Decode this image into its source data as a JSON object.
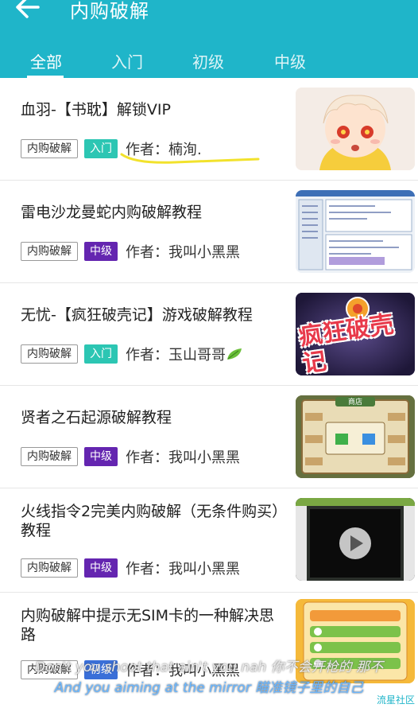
{
  "header": {
    "title": "内购破解"
  },
  "tabs": [
    "全部",
    "入门",
    "初级",
    "中级"
  ],
  "colors": {
    "accent": "#1fb5c9",
    "level_entry": "#2cc6b3",
    "level_mid": "#6425b0"
  },
  "items": [
    {
      "title": "血羽-【书耽】解锁VIP",
      "category": "内购破解",
      "level": "入门",
      "author": "作者：楠洵."
    },
    {
      "title": "雷电沙龙曼蛇内购破解教程",
      "category": "内购破解",
      "level": "中级",
      "author": "作者：我叫小黑黑"
    },
    {
      "title": "无忧-【疯狂破壳记】游戏破解教程",
      "category": "内购破解",
      "level": "入门",
      "author": "作者：玉山哥哥"
    },
    {
      "title": "贤者之石起源破解教程",
      "category": "内购破解",
      "level": "中级",
      "author": "作者：我叫小黑黑"
    },
    {
      "title": "火线指令2完美内购破解（无条件购买）教程",
      "category": "内购破解",
      "level": "中级",
      "author": "作者：我叫小黑黑"
    },
    {
      "title": "内购破解中提示无SIM卡的一种解决思路",
      "category": "内购破解",
      "level": "初级",
      "author": "作者：我叫小黑黑"
    }
  ],
  "thumb_texts": {
    "crazy_title": "疯狂破壳记",
    "shop": "商店"
  },
  "subtitles": {
    "line1": "Don't you shoot that ain't you nah 你不会开枪的 那不",
    "line2": "And you aiming at the mirror 瞄准镜子里的自己"
  },
  "watermark": "流星社区"
}
